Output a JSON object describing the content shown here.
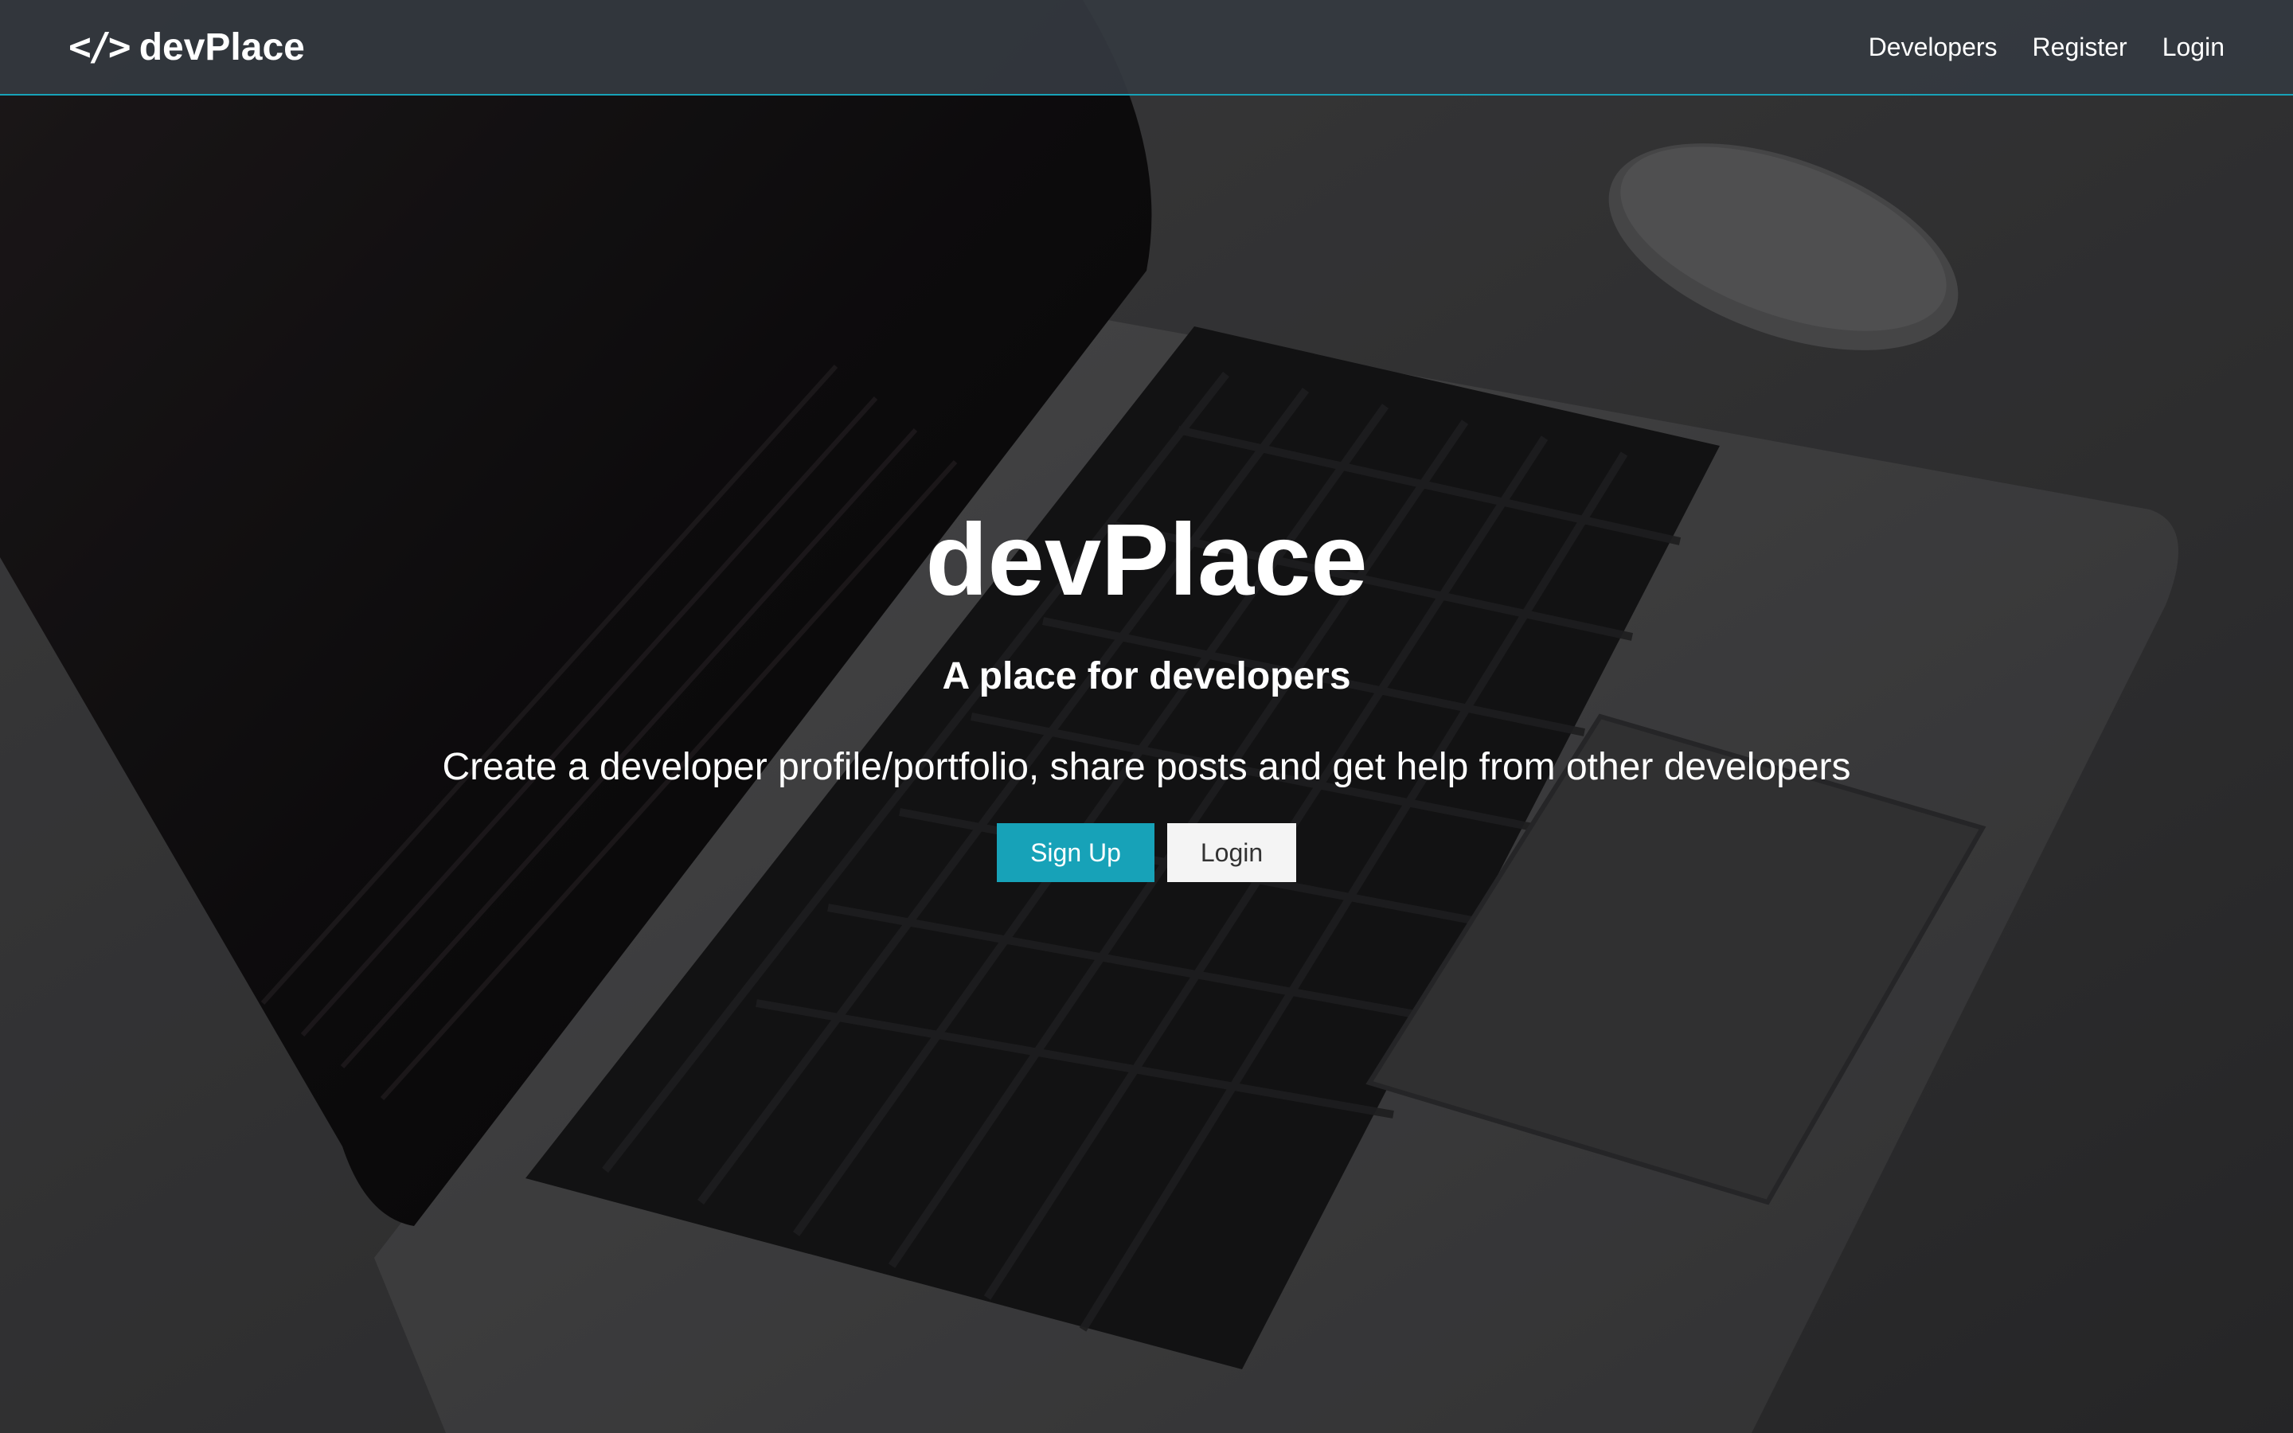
{
  "navbar": {
    "brand_icon": "</>",
    "brand_text": "devPlace",
    "links": [
      {
        "label": "Developers"
      },
      {
        "label": "Register"
      },
      {
        "label": "Login"
      }
    ]
  },
  "landing": {
    "title": "devPlace",
    "subtitle": "A place for developers",
    "lead": "Create a developer profile/portfolio, share posts and get help from other developers",
    "signup_label": "Sign Up",
    "login_label": "Login"
  },
  "colors": {
    "accent": "#17a2b8",
    "navbar_bg": "#343a40",
    "light_button": "#f4f4f4"
  },
  "icons": {
    "brand": "code-icon"
  }
}
